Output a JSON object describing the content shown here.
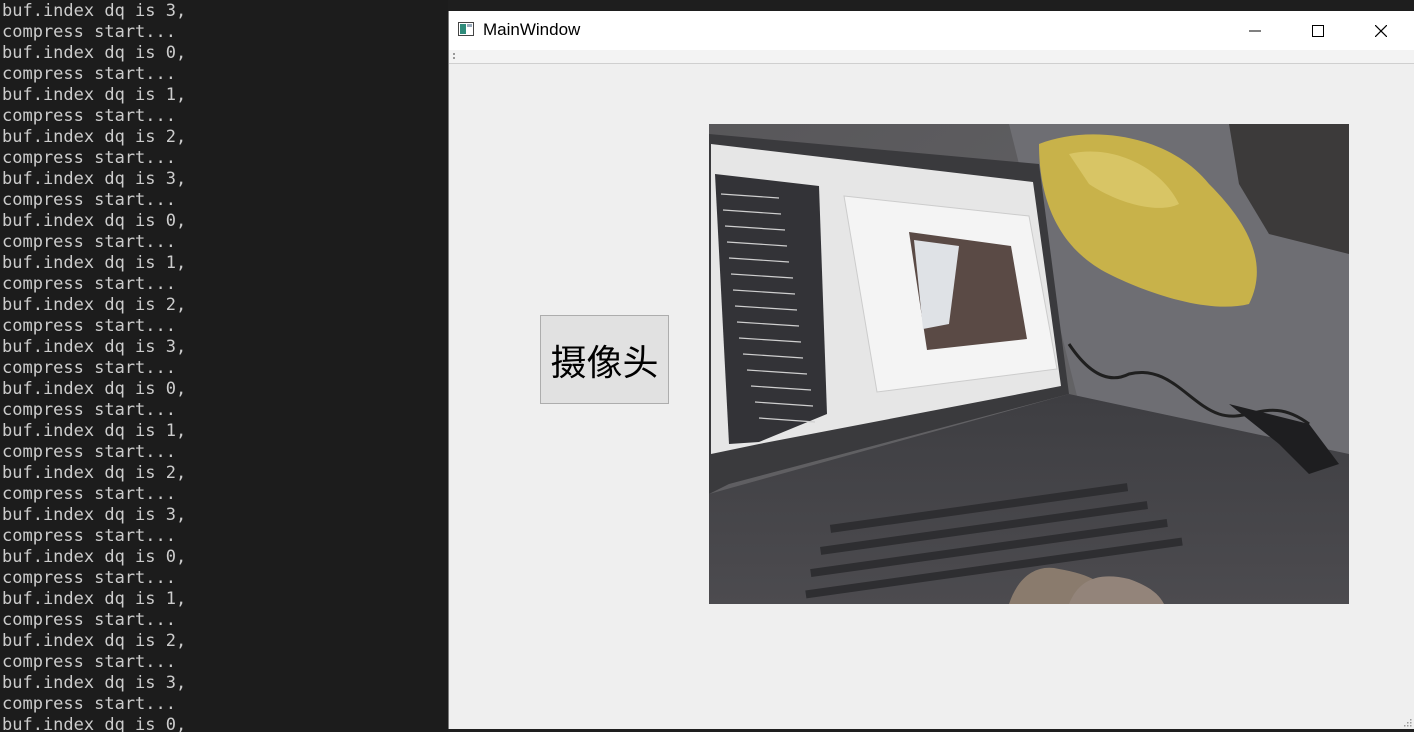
{
  "terminal": {
    "lines": [
      "buf.index dq is 3,",
      "compress start...",
      "buf.index dq is 0,",
      "compress start...",
      "buf.index dq is 1,",
      "compress start...",
      "buf.index dq is 2,",
      "compress start...",
      "buf.index dq is 3,",
      "compress start...",
      "buf.index dq is 0,",
      "compress start...",
      "buf.index dq is 1,",
      "compress start...",
      "buf.index dq is 2,",
      "compress start...",
      "buf.index dq is 3,",
      "compress start...",
      "buf.index dq is 0,",
      "compress start...",
      "buf.index dq is 1,",
      "compress start...",
      "buf.index dq is 2,",
      "compress start...",
      "buf.index dq is 3,",
      "compress start...",
      "buf.index dq is 0,",
      "compress start...",
      "buf.index dq is 1,",
      "compress start...",
      "buf.index dq is 2,",
      "compress start...",
      "buf.index dq is 3,",
      "compress start...",
      "buf.index dq is 0,"
    ]
  },
  "window": {
    "title": "MainWindow",
    "icon": "app-window-icon",
    "controls": {
      "minimize_icon": "minimize-icon",
      "maximize_icon": "maximize-icon",
      "close_icon": "close-icon"
    }
  },
  "main": {
    "camera_button_label": "摄像头",
    "camera_view_icon": "camera-feed-image"
  },
  "colors": {
    "terminal_bg": "#1c1c1c",
    "terminal_text": "#cccccc",
    "window_bg": "#efefef",
    "titlebar_bg": "#ffffff",
    "button_bg": "#e1e1e1"
  }
}
